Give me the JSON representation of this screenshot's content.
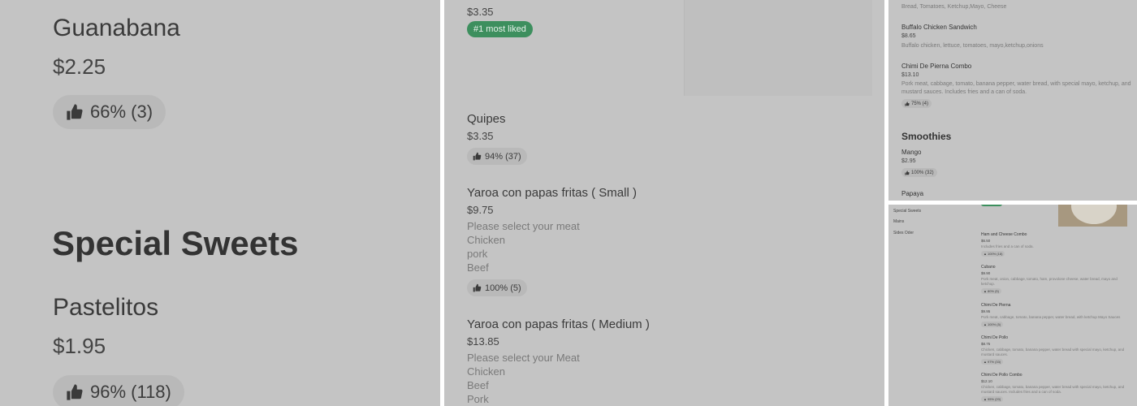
{
  "panel1": {
    "item1": {
      "name": "Guanabana",
      "price": "$2.25",
      "rating": "66% (3)"
    },
    "section": "Special Sweets",
    "item2": {
      "name": "Pastelitos",
      "price": "$1.95",
      "rating": "96% (118)"
    }
  },
  "panel2": {
    "top_price": "$3.35",
    "top_badge": "#1 most liked",
    "items": [
      {
        "name": "Quipes",
        "price": "$3.35",
        "rating": "94% (37)"
      },
      {
        "name": "Yaroa con papas fritas ( Small )",
        "price": "$9.75",
        "options": [
          "Please select your meat",
          "Chicken",
          "pork",
          "Beef"
        ],
        "rating": "100% (5)"
      },
      {
        "name": "Yaroa con papas fritas ( Medium )",
        "price": "$13.85",
        "options": [
          "Please select your Meat",
          "Chicken",
          "Beef",
          "Pork"
        ]
      }
    ]
  },
  "panel3": {
    "top_desc": "Bread, Tomatoes, Ketchup,Mayo, Cheese",
    "items": [
      {
        "name": "Buffalo Chicken Sandwich",
        "price": "$8.65",
        "desc": "Buffalo chicken, lettuce, tomatoes, mayo,ketchup,onions"
      },
      {
        "name": "Chimi De Pierna Combo",
        "price": "$13.10",
        "desc1": "Pork meat, cabbage, tomato, banana pepper, water bread, with special mayo, ketchup, and",
        "desc2": "mustard sauces. Includes fries and a can of soda.",
        "rating": "75% (4)"
      }
    ],
    "section": "Smoothies",
    "smoothies": [
      {
        "name": "Mango",
        "price": "$2.95",
        "rating": "100% (32)"
      },
      {
        "name": "Papaya"
      }
    ]
  },
  "panel4": {
    "nav": [
      "Special Sweets",
      "Mains",
      "Sides Oder"
    ],
    "items": [
      {
        "name": "Ham and Cheese Combo",
        "price": "$6.50",
        "desc1": "Includes fries and a can of soda.",
        "desc2": "",
        "rating": "100% (18)"
      },
      {
        "name": "Cubano",
        "price": "$9.90",
        "desc1": "Pork meat, onion, cabbage, tomato, ham, provolone cheese, water bread, mayo and",
        "desc2": "ketchup.",
        "rating": "80% (5)"
      },
      {
        "name": "Chimi De Pierna",
        "price": "$9.95",
        "desc1": "Pork meat, cabbage, tomato, banana pepper, water bread, with ketchup Mayo Sauces",
        "desc2": "",
        "rating": "100% (5)"
      },
      {
        "name": "Chimi De Pollo",
        "price": "$8.75",
        "desc1": "Chicken, cabbage, tomato, banana pepper, water bread with special mayo, ketchup, and",
        "desc2": "mustard sauces.",
        "rating": "97% (33)"
      },
      {
        "name": "Chimi De Pollo Combo",
        "price": "$12.10",
        "desc1": "Chicken, cabbage, tomato, banana pepper, water bread with special mayo, ketchup, and",
        "desc2": "mustard sauces. Includes fries and a can of soda.",
        "rating": "95% (20)"
      }
    ]
  },
  "colors": {
    "panel_bg": "#c4c4c4",
    "pill_bg": "#b9b9b9",
    "badge_green": "#3d8f5e",
    "text": "#3b3b3b",
    "muted": "#7a7a7a"
  }
}
